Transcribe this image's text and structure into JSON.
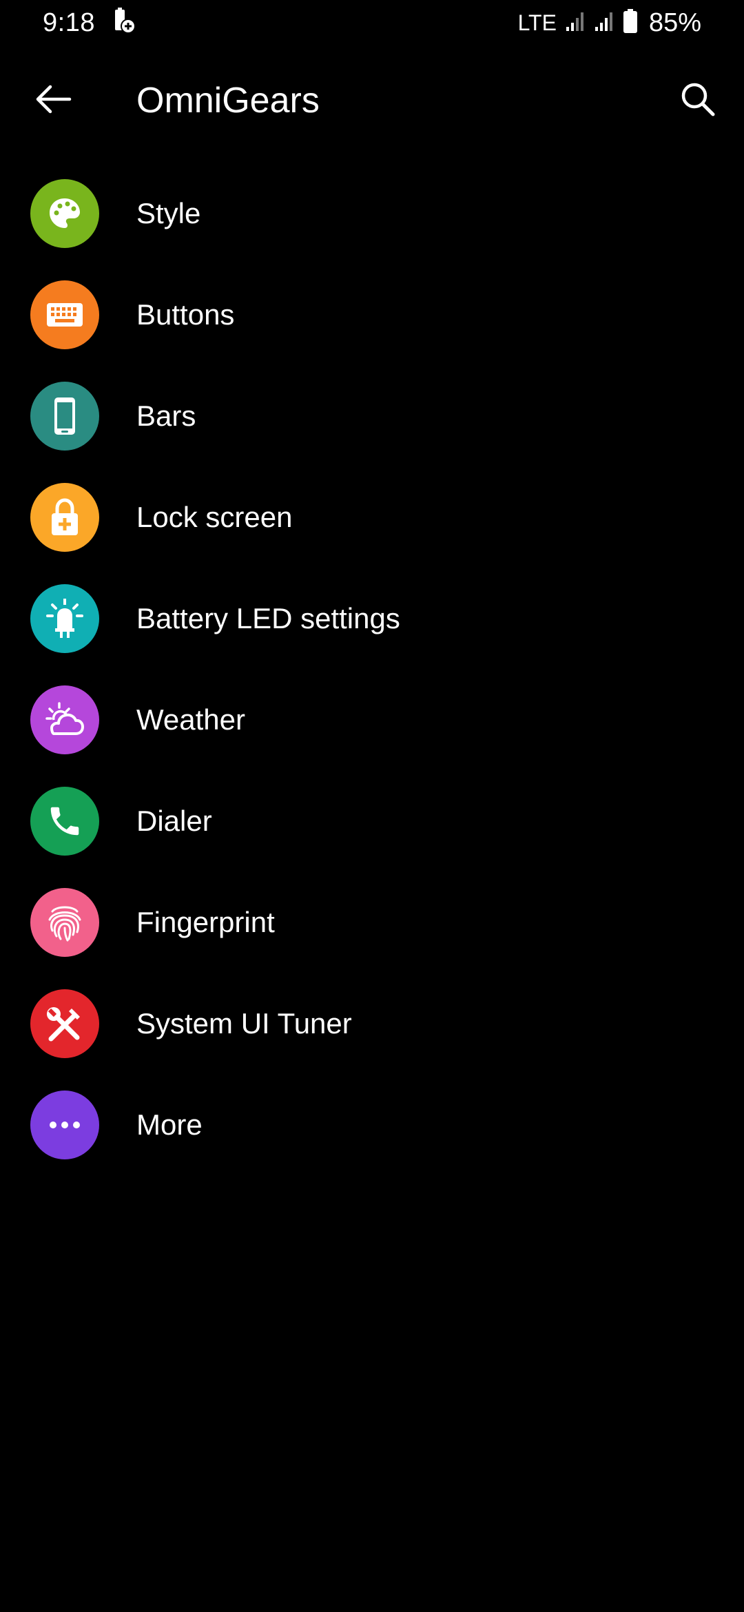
{
  "status_bar": {
    "time": "9:18",
    "network": "LTE",
    "battery_percent": "85%",
    "battery_level": 0.85
  },
  "app_bar": {
    "title": "OmniGears",
    "back_icon": "arrow-back-icon",
    "search_icon": "search-icon"
  },
  "menu": {
    "items": [
      {
        "label": "Style",
        "icon": "palette-icon",
        "color": "#79B51D"
      },
      {
        "label": "Buttons",
        "icon": "keyboard-icon",
        "color": "#F57C1F"
      },
      {
        "label": "Bars",
        "icon": "phone-icon",
        "color": "#2A8C82"
      },
      {
        "label": "Lock screen",
        "icon": "lock-icon",
        "color": "#FBA728"
      },
      {
        "label": "Battery LED settings",
        "icon": "led-icon",
        "color": "#10AFB4"
      },
      {
        "label": "Weather",
        "icon": "weather-icon",
        "color": "#B547DB"
      },
      {
        "label": "Dialer",
        "icon": "call-icon",
        "color": "#15A055"
      },
      {
        "label": "Fingerprint",
        "icon": "fingerprint-icon",
        "color": "#F2618B"
      },
      {
        "label": "System UI Tuner",
        "icon": "tools-icon",
        "color": "#E3262C"
      },
      {
        "label": "More",
        "icon": "more-icon",
        "color": "#7C3DE0"
      }
    ]
  }
}
